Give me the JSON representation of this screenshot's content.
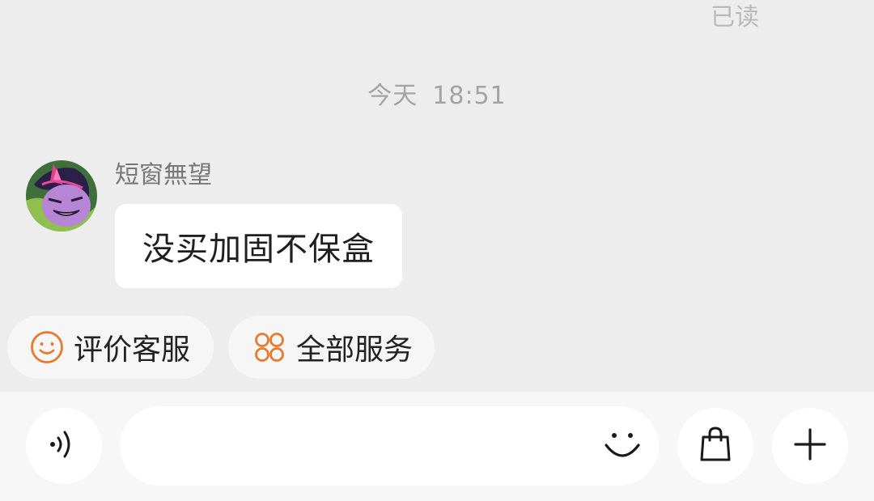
{
  "chat": {
    "read_status": "已读",
    "time_divider": {
      "day": "今天",
      "time": "18:51"
    },
    "messages": [
      {
        "sender_name": "短窗無望",
        "text": "没买加固不保盒"
      }
    ]
  },
  "quick_actions": [
    {
      "label": "评价客服",
      "icon": "smiley-face-icon"
    },
    {
      "label": "全部服务",
      "icon": "four-circles-icon"
    }
  ],
  "input_bar": {
    "input_value": "",
    "placeholder": "",
    "voice_icon": "voice-wave-icon",
    "emoji_icon": "smiley-icon",
    "shop_icon": "shopping-bag-icon",
    "more_icon": "plus-icon"
  },
  "colors": {
    "chat_background": "#ededed",
    "input_bar_background": "#f7f7f7",
    "accent_orange": "#e87a2e",
    "bubble_background": "#ffffff"
  }
}
